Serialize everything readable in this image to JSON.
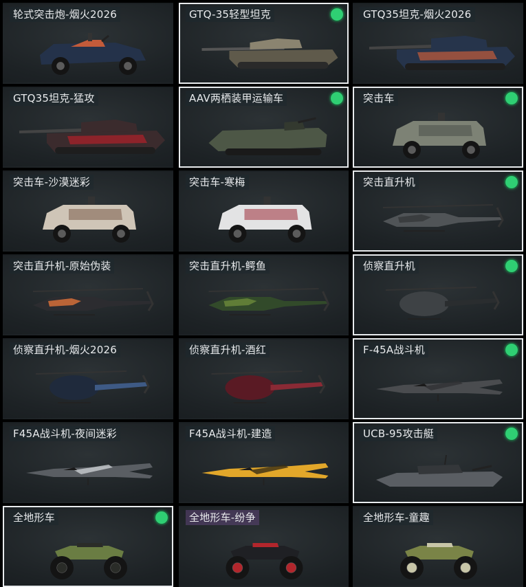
{
  "cards": [
    {
      "label": "轮式突击炮-烟火2026",
      "selected": false,
      "icon": "wheeled-assault-gun-icon",
      "colors": [
        "#24324a",
        "#c35b3a"
      ]
    },
    {
      "label": "GTQ-35轻型坦克",
      "selected": true,
      "icon": "light-tank-icon",
      "colors": [
        "#8b8470",
        "#5f5a4b"
      ]
    },
    {
      "label": "GTQ35坦克-烟火2026",
      "selected": false,
      "icon": "tank-icon",
      "colors": [
        "#26344b",
        "#c55c3b"
      ]
    },
    {
      "label": "GTQ35坦克-猛攻",
      "selected": false,
      "icon": "tank-icon",
      "colors": [
        "#3b2b2d",
        "#b0212a"
      ]
    },
    {
      "label": "AAV两栖装甲运输车",
      "selected": true,
      "icon": "amphibious-apc-icon",
      "colors": [
        "#4d5746",
        "#33392f"
      ]
    },
    {
      "label": "突击车",
      "selected": true,
      "icon": "assault-vehicle-icon",
      "colors": [
        "#7d8275",
        "#4b5048"
      ]
    },
    {
      "label": "突击车-沙漠迷彩",
      "selected": false,
      "icon": "assault-vehicle-icon",
      "colors": [
        "#cfc5b7",
        "#7b5d4d"
      ]
    },
    {
      "label": "突击车-寒梅",
      "selected": false,
      "icon": "assault-vehicle-icon",
      "colors": [
        "#e3e3e4",
        "#9e2f3a"
      ]
    },
    {
      "label": "突击直升机",
      "selected": true,
      "icon": "attack-helicopter-icon",
      "colors": [
        "#505457",
        "#343739"
      ]
    },
    {
      "label": "突击直升机-原始伪装",
      "selected": false,
      "icon": "attack-helicopter-icon",
      "colors": [
        "#2c2c30",
        "#e0733a"
      ]
    },
    {
      "label": "突击直升机-鳄鱼",
      "selected": false,
      "icon": "attack-helicopter-icon",
      "colors": [
        "#324a2a",
        "#6c8a3b"
      ]
    },
    {
      "label": "侦察直升机",
      "selected": true,
      "icon": "scout-helicopter-icon",
      "colors": [
        "#3e4245",
        "#2a2d2f"
      ]
    },
    {
      "label": "侦察直升机-烟火2026",
      "selected": false,
      "icon": "scout-helicopter-icon",
      "colors": [
        "#1f2a3c",
        "#3e5a85"
      ]
    },
    {
      "label": "侦察直升机-酒红",
      "selected": false,
      "icon": "scout-helicopter-icon",
      "colors": [
        "#5a1a24",
        "#8a2a35"
      ]
    },
    {
      "label": "F-45A战斗机",
      "selected": true,
      "icon": "fighter-jet-icon",
      "colors": [
        "#4a4c4f",
        "#2f3133"
      ]
    },
    {
      "label": "F45A战斗机-夜间迷彩",
      "selected": false,
      "icon": "fighter-jet-icon",
      "colors": [
        "#5a5e63",
        "#c9cdd1"
      ]
    },
    {
      "label": "F45A战斗机-建造",
      "selected": false,
      "icon": "fighter-jet-icon",
      "colors": [
        "#e2a72a",
        "#3a2e14"
      ]
    },
    {
      "label": "UCB-95攻击艇",
      "selected": true,
      "icon": "attack-boat-icon",
      "colors": [
        "#5a5e63",
        "#34373a"
      ]
    },
    {
      "label": "全地形车",
      "selected": true,
      "icon": "atv-icon",
      "colors": [
        "#6a7d43",
        "#2a2c28"
      ]
    },
    {
      "label": "全地形车-纷争",
      "selected": false,
      "icon": "atv-icon",
      "colors": [
        "#1f2024",
        "#b2262c"
      ]
    },
    {
      "label": "全地形车-童趣",
      "selected": false,
      "icon": "atv-icon",
      "colors": [
        "#7a8447",
        "#c8c6a8"
      ]
    }
  ]
}
